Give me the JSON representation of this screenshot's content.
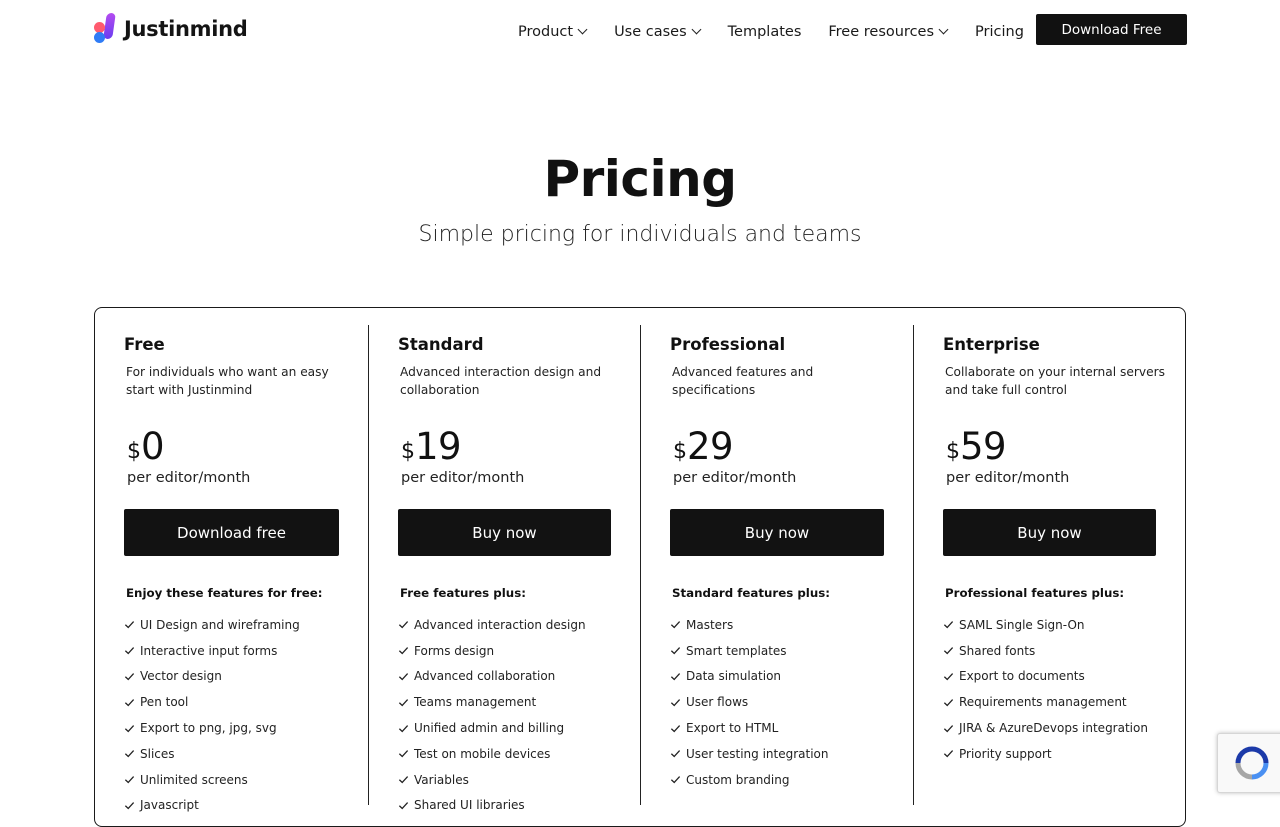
{
  "header": {
    "logo_text": "Justinmind",
    "nav": [
      {
        "label": "Product",
        "has_dropdown": true
      },
      {
        "label": "Use cases",
        "has_dropdown": true
      },
      {
        "label": "Templates",
        "has_dropdown": false
      },
      {
        "label": "Free resources",
        "has_dropdown": true
      },
      {
        "label": "Pricing",
        "has_dropdown": false
      }
    ],
    "download_button": "Download Free"
  },
  "hero": {
    "title": "Pricing",
    "subtitle": "Simple pricing for individuals and teams"
  },
  "plans": [
    {
      "name": "Free",
      "description": "For individuals who want an easy start with Justinmind",
      "currency": "$",
      "amount": "0",
      "period": "per editor/month",
      "cta": "Download free",
      "features_heading": "Enjoy these features for free:",
      "features": [
        "UI Design and wireframing",
        "Interactive input forms",
        "Vector design",
        "Pen tool",
        "Export to png, jpg, svg",
        "Slices",
        "Unlimited screens",
        "Javascript"
      ]
    },
    {
      "name": "Standard",
      "description": "Advanced interaction design and collaboration",
      "currency": "$",
      "amount": "19",
      "period": "per editor/month",
      "cta": "Buy now",
      "features_heading": "Free features plus:",
      "features": [
        "Advanced interaction design",
        "Forms design",
        "Advanced collaboration",
        "Teams management",
        "Unified admin and billing",
        "Test on mobile devices",
        "Variables",
        "Shared UI libraries"
      ]
    },
    {
      "name": "Professional",
      "description": "Advanced features and specifications",
      "currency": "$",
      "amount": "29",
      "period": "per editor/month",
      "cta": "Buy now",
      "features_heading": "Standard features plus:",
      "features": [
        "Masters",
        "Smart templates",
        "Data simulation",
        "User flows",
        "Export to HTML",
        "User testing integration",
        "Custom branding"
      ]
    },
    {
      "name": "Enterprise",
      "description": "Collaborate on your internal servers and take full control",
      "currency": "$",
      "amount": "59",
      "period": "per editor/month",
      "cta": "Buy now",
      "features_heading": "Professional features plus:",
      "features": [
        "SAML Single Sign-On",
        "Shared fonts",
        "Export to documents",
        "Requirements management",
        "JIRA & AzureDevops integration",
        "Priority support"
      ]
    }
  ],
  "colors": {
    "button_bg": "#121212",
    "logo_purple": "#8a45f0",
    "logo_red": "#ff5a6e",
    "logo_blue": "#2f7cf6"
  },
  "icons": {
    "feature_check": "check-icon",
    "nav_dropdown": "chevron-down-icon",
    "recaptcha": "recaptcha-icon"
  }
}
